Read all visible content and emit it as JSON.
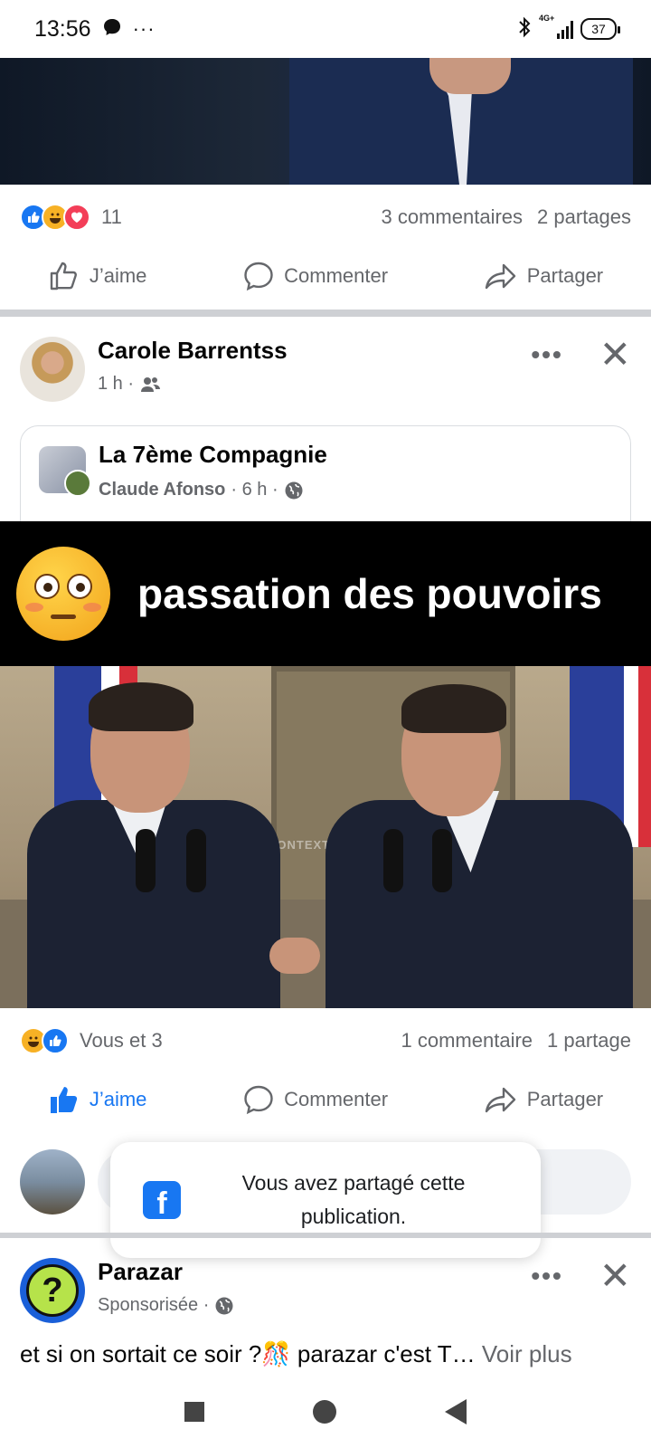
{
  "status_bar": {
    "time": "13:56",
    "network": "4G+",
    "battery": "37"
  },
  "post1": {
    "reaction_count": "11",
    "comments": "3 commentaires",
    "shares": "2 partages",
    "actions": {
      "like": "J’aime",
      "comment": "Commenter",
      "share": "Partager"
    }
  },
  "post2": {
    "author": "Carole Barrentss",
    "time": "1 h ·",
    "shared": {
      "page": "La 7ème Compagnie",
      "author": "Claude Afonso",
      "time": "· 6 h ·"
    },
    "banner_text": "passation des pouvoirs",
    "photo_watermark": "CONTEXT",
    "reaction_summary": "Vous et 3",
    "comments": "1 commentaire",
    "shares": "1 partage",
    "actions": {
      "like": "J’aime",
      "comment": "Commenter",
      "share": "Partager"
    }
  },
  "toast": {
    "message": "Vous avez partagé cette publication."
  },
  "ad": {
    "name": "Parazar",
    "label": "Sponsorisée ·",
    "text": "et si on sortait ce soir ?🎊 parazar c'est T…",
    "more": "Voir plus"
  },
  "colors": {
    "facebook_blue": "#1877f2",
    "gray_text": "#65676b",
    "divider": "#ced0d4"
  }
}
